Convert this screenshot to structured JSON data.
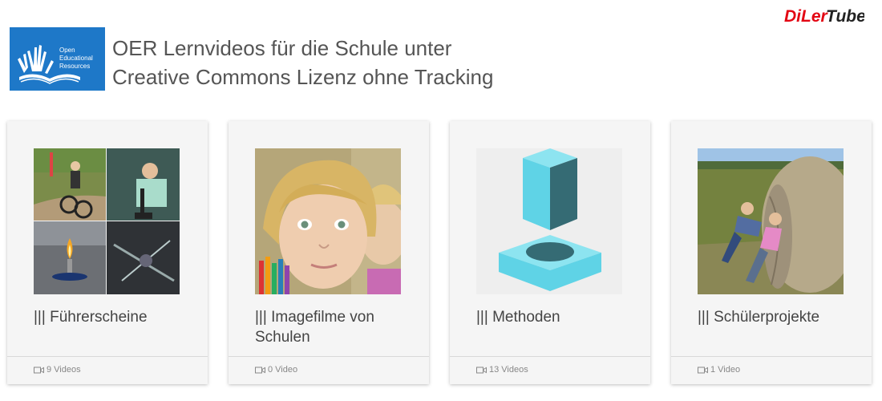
{
  "header": {
    "brand_logo_text": "DiLerTube",
    "oer_logo_lines": [
      "Open",
      "Educational",
      "Resources"
    ],
    "title_line1": "OER Lernvideos für die Schule unter",
    "title_line2": "Creative Commons Lizenz ohne Tracking"
  },
  "cards": [
    {
      "title": "||| Führerscheine",
      "count": "9 Videos",
      "thumb": "collage-icon"
    },
    {
      "title": "||| Imagefilme von Schulen",
      "count": "0 Video",
      "thumb": "child-photo"
    },
    {
      "title": "||| Methoden",
      "count": "13 Videos",
      "thumb": "shapes-icon"
    },
    {
      "title": "||| Schülerprojekte",
      "count": "1 Video",
      "thumb": "hay-bale-photo"
    }
  ],
  "colors": {
    "accent_red": "#e30613",
    "oer_blue": "#1e78c8",
    "card_bg": "#f5f5f5",
    "shape_cyan": "#5fd3e6"
  }
}
